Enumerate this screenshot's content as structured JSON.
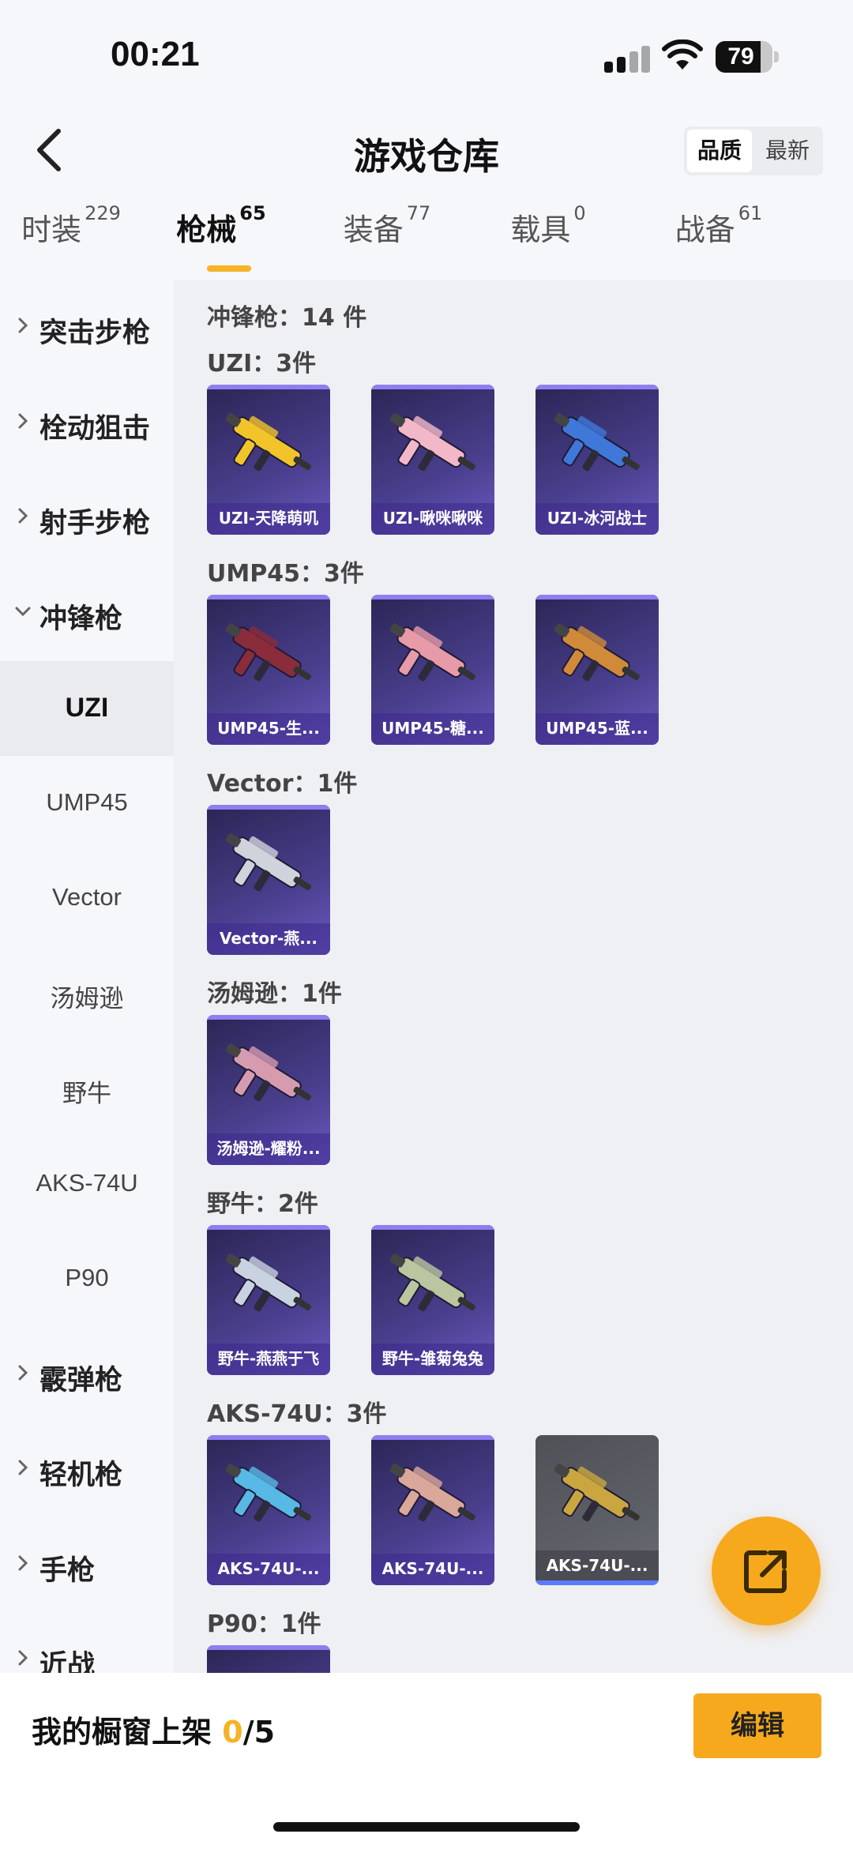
{
  "status": {
    "time": "00:21",
    "battery": "79"
  },
  "header": {
    "title": "游戏仓库",
    "sort_options": [
      "品质",
      "最新"
    ],
    "sort_active": 0
  },
  "tabs": [
    {
      "label": "时装",
      "count": "229"
    },
    {
      "label": "枪械",
      "count": "65",
      "active": true
    },
    {
      "label": "装备",
      "count": "77"
    },
    {
      "label": "载具",
      "count": "0"
    },
    {
      "label": "战备",
      "count": "61"
    }
  ],
  "sidebar": {
    "items": [
      {
        "label": "突击步枪",
        "type": "category",
        "expanded": false
      },
      {
        "label": "栓动狙击",
        "type": "category",
        "expanded": false
      },
      {
        "label": "射手步枪",
        "type": "category",
        "expanded": false
      },
      {
        "label": "冲锋枪",
        "type": "category",
        "expanded": true
      },
      {
        "label": "UZI",
        "type": "sub",
        "active": true
      },
      {
        "label": "UMP45",
        "type": "sub"
      },
      {
        "label": "Vector",
        "type": "sub"
      },
      {
        "label": "汤姆逊",
        "type": "sub"
      },
      {
        "label": "野牛",
        "type": "sub"
      },
      {
        "label": "AKS-74U",
        "type": "sub"
      },
      {
        "label": "P90",
        "type": "sub"
      },
      {
        "label": "霰弹枪",
        "type": "category",
        "expanded": false
      },
      {
        "label": "轻机枪",
        "type": "category",
        "expanded": false
      },
      {
        "label": "手枪",
        "type": "category",
        "expanded": false
      },
      {
        "label": "近战",
        "type": "category",
        "expanded": false
      }
    ]
  },
  "content": {
    "category_title": "冲锋枪：14 件",
    "groups": [
      {
        "title": "UZI：3件",
        "items": [
          {
            "name": "UZI-天降萌叽",
            "color": "#f2c42a"
          },
          {
            "name": "UZI-啾咪啾咪",
            "color": "#f3b8c8"
          },
          {
            "name": "UZI-冰河战士",
            "color": "#3f78d8"
          }
        ]
      },
      {
        "title": "UMP45：3件",
        "items": [
          {
            "name": "UMP45-生...",
            "color": "#8a2c3a"
          },
          {
            "name": "UMP45-糖...",
            "color": "#e79aa8"
          },
          {
            "name": "UMP45-蓝...",
            "color": "#d08a3a"
          }
        ]
      },
      {
        "title": "Vector：1件",
        "items": [
          {
            "name": "Vector-燕...",
            "color": "#cfd3dc"
          }
        ]
      },
      {
        "title": "汤姆逊：1件",
        "items": [
          {
            "name": "汤姆逊-耀粉...",
            "color": "#d79bb0"
          }
        ]
      },
      {
        "title": "野牛：2件",
        "items": [
          {
            "name": "野牛-燕燕于飞",
            "color": "#c9d2e0"
          },
          {
            "name": "野牛-雏菊兔兔",
            "color": "#b9c6a0"
          }
        ]
      },
      {
        "title": "AKS-74U：3件",
        "items": [
          {
            "name": "AKS-74U-...",
            "color": "#58b8e6"
          },
          {
            "name": "AKS-74U-...",
            "color": "#d9a89a"
          },
          {
            "name": "AKS-74U-...",
            "color": "#c9a640",
            "grey": true
          }
        ]
      },
      {
        "title": "P90：1件",
        "items": []
      }
    ]
  },
  "bottom": {
    "showcase_label": "我的橱窗上架 ",
    "showcase_current": "0",
    "showcase_total": "/5",
    "edit_label": "编辑"
  }
}
